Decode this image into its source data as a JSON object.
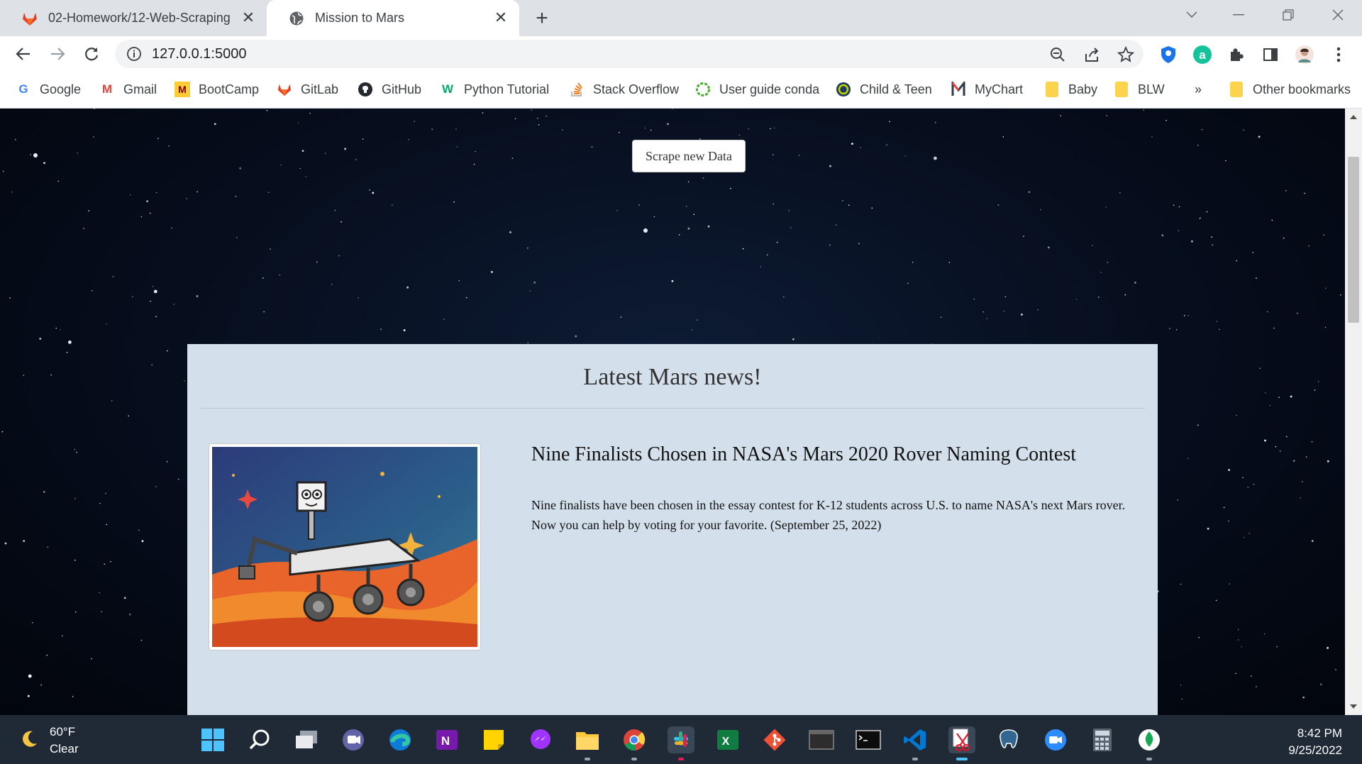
{
  "browser": {
    "tabs": [
      {
        "title": "02-Homework/12-Web-Scraping",
        "icon": "gitlab-icon",
        "active": false
      },
      {
        "title": "Mission to Mars",
        "icon": "globe-icon",
        "active": true
      }
    ],
    "address": "127.0.0.1:5000",
    "bookmarks": [
      {
        "label": "Google",
        "icon": "google-icon"
      },
      {
        "label": "Gmail",
        "icon": "gmail-icon"
      },
      {
        "label": "BootCamp",
        "icon": "bootcamp-icon"
      },
      {
        "label": "GitLab",
        "icon": "gitlab-icon"
      },
      {
        "label": "GitHub",
        "icon": "github-icon"
      },
      {
        "label": "Python Tutorial",
        "icon": "w3schools-icon"
      },
      {
        "label": "Stack Overflow",
        "icon": "stackoverflow-icon"
      },
      {
        "label": "User guide conda",
        "icon": "conda-icon"
      },
      {
        "label": "Child & Teen",
        "icon": "circle-logo-icon"
      },
      {
        "label": "MyChart",
        "icon": "mychart-icon"
      },
      {
        "label": "Baby",
        "icon": "folder-icon"
      },
      {
        "label": "BLW",
        "icon": "folder-icon"
      }
    ],
    "bookmarks_overflow": "»",
    "other_bookmarks": "Other bookmarks"
  },
  "page": {
    "scrape_button": "Scrape new Data",
    "news_heading": "Latest Mars news!",
    "article": {
      "title": "Nine Finalists Chosen in NASA's Mars 2020 Rover Naming Contest",
      "body": "Nine finalists have been chosen in the essay contest for K-12 students across U.S. to name NASA's next Mars rover. Now you can help by voting for your favorite. (September 25, 2022)"
    }
  },
  "taskbar": {
    "weather": {
      "temp": "60°F",
      "condition": "Clear"
    },
    "time": "8:42 PM",
    "date": "9/25/2022",
    "apps": [
      "windows-start-icon",
      "search-icon",
      "task-view-icon",
      "teams-chat-icon",
      "edge-icon",
      "onenote-icon",
      "sticky-notes-icon",
      "messenger-icon",
      "file-explorer-icon",
      "chrome-icon",
      "slack-icon",
      "excel-icon",
      "git-icon",
      "terminal-icon",
      "command-prompt-icon",
      "vscode-icon",
      "snipping-tool-icon",
      "postgresql-icon",
      "zoom-icon",
      "calculator-icon",
      "mongodb-icon"
    ]
  }
}
